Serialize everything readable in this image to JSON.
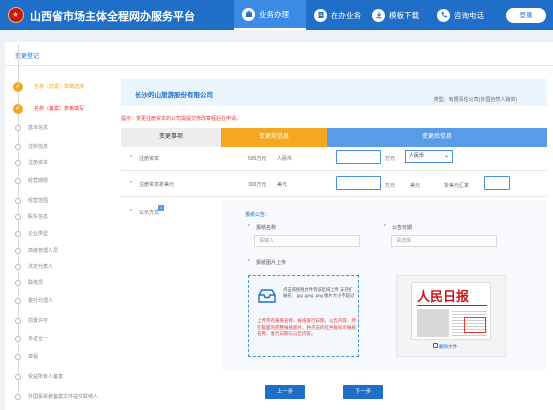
{
  "header": {
    "site_title": "山西省市场主体全程网办服务平台",
    "nav": [
      {
        "label": "业务办理",
        "icon": "briefcase-icon",
        "active": true
      },
      {
        "label": "在办业务",
        "icon": "document-icon",
        "active": false
      },
      {
        "label": "模板下载",
        "icon": "download-icon",
        "active": false
      },
      {
        "label": "咨询电话",
        "icon": "phone-icon",
        "active": false
      }
    ],
    "login_label": "登录"
  },
  "page": {
    "title": "变更登记"
  },
  "steps": [
    {
      "label": "名称（前置）草稿选择",
      "state": "done"
    },
    {
      "label": "名称（备案）表格填写",
      "state": "current"
    },
    {
      "label": "基本信息",
      "state": "todo"
    },
    {
      "label": "住所信息",
      "state": "todo"
    },
    {
      "label": "注册资本",
      "state": "todo"
    },
    {
      "label": "经营期限",
      "state": "todo"
    },
    {
      "label": "经营范围",
      "state": "todo"
    },
    {
      "label": "股东信息",
      "state": "todo"
    },
    {
      "label": "企业类型",
      "state": "todo"
    },
    {
      "label": "高级管理人员",
      "state": "todo"
    },
    {
      "label": "法定代表人",
      "state": "todo"
    },
    {
      "label": "联络员",
      "state": "todo"
    },
    {
      "label": "委托代理人",
      "state": "todo"
    },
    {
      "label": "前置许可",
      "state": "todo"
    },
    {
      "label": "多证合一",
      "state": "todo"
    },
    {
      "label": "章程",
      "state": "todo"
    },
    {
      "label": "受益所有人备案",
      "state": "todo"
    },
    {
      "label": "外国投资者备案文件提交联络人",
      "state": "todo"
    }
  ],
  "company": {
    "name": "长沙的山旅游股份有限公司",
    "type_label": "类型：有限责任公司(外国自然人独资)"
  },
  "tip": "提示：变更注册资本的公司需提交修改章程后在申请。",
  "table": {
    "headers": {
      "item": "变更事项",
      "before": "变更前信息",
      "after": "变更后信息"
    },
    "rows": [
      {
        "label": "注册资本",
        "before_value": "500万元",
        "before_currency": "人民币",
        "after_unit": "万元",
        "after_currency": "人民币"
      },
      {
        "label": "注册资本折美元",
        "before_value": "300万元",
        "before_currency": "美元",
        "after_unit": "万元",
        "after_currency_unit": "美元",
        "after_rate_label": "折美元汇率"
      }
    ]
  },
  "notice": {
    "label": "公示方式",
    "section_label": "报纸公告：",
    "newspaper_label": "报纸名称",
    "newspaper_placeholder": "请输入",
    "date_label": "公告日期",
    "date_placeholder": "请选择",
    "upload_label": "报纸图片上传",
    "upload_hint": "点击或拖拽文件到该区域上传 支持扩展名：.jpg .jpeg .png 图片大小不超过",
    "upload_warning": "上传带有报纸名称、报纸发行日期、公告内容、所在版面的完整报纸图片，并点击的红色框标示报纸名称、发行日期与公告内容。",
    "sample_masthead": "人民日报",
    "sample_link": "删除文件"
  },
  "buttons": {
    "prev": "上一步",
    "next": "下一步"
  }
}
